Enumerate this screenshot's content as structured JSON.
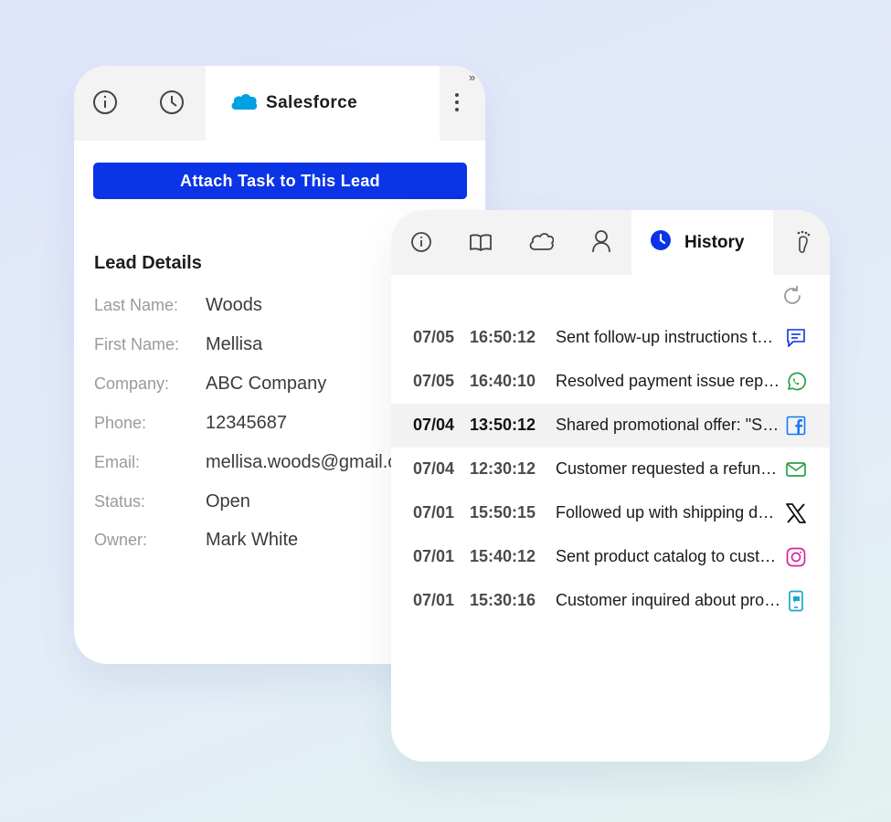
{
  "salesforce_panel": {
    "tabs": [
      {
        "icon": "info-icon"
      },
      {
        "icon": "clock-icon"
      },
      {
        "icon": "salesforce-cloud-icon",
        "label": "Salesforce",
        "active": true
      }
    ],
    "menu_icon": "more-vertical-icon",
    "attach_button_label": "Attach Task to This Lead",
    "lead_details": {
      "title": "Lead Details",
      "fields": [
        {
          "label": "Last Name:",
          "value": "Woods"
        },
        {
          "label": "First Name:",
          "value": "Mellisa"
        },
        {
          "label": "Company:",
          "value": "ABC Company"
        },
        {
          "label": "Phone:",
          "value": "12345687"
        },
        {
          "label": "Email:",
          "value": "mellisa.woods@gmail.com"
        },
        {
          "label": "Status:",
          "value": "Open"
        },
        {
          "label": "Owner:",
          "value": "Mark White"
        }
      ]
    }
  },
  "history_panel": {
    "tabs": [
      {
        "icon": "info-icon"
      },
      {
        "icon": "book-icon"
      },
      {
        "icon": "cloud-icon"
      },
      {
        "icon": "user-icon"
      },
      {
        "icon": "clock-icon",
        "label": "History",
        "active": true
      },
      {
        "icon": "footprint-icon"
      }
    ],
    "refresh_icon": "refresh-icon",
    "items": [
      {
        "date": "07/05",
        "time": "16:50:12",
        "text": "Sent follow-up instructions to the customer",
        "channel": "chat-icon"
      },
      {
        "date": "07/05",
        "time": "16:40:10",
        "text": "Resolved payment issue reported by customer",
        "channel": "whatsapp-icon"
      },
      {
        "date": "07/04",
        "time": "13:50:12",
        "text": "Shared promotional offer: \"Summer Sale\"",
        "channel": "facebook-icon"
      },
      {
        "date": "07/04",
        "time": "12:30:12",
        "text": "Customer requested a refund for order",
        "channel": "email-icon"
      },
      {
        "date": "07/01",
        "time": "15:50:15",
        "text": "Followed up with shipping details",
        "channel": "x-icon"
      },
      {
        "date": "07/01",
        "time": "15:40:12",
        "text": "Sent product catalog to customer",
        "channel": "instagram-icon"
      },
      {
        "date": "07/01",
        "time": "15:30:16",
        "text": "Customer inquired about product availability",
        "channel": "sms-icon"
      }
    ]
  },
  "colors": {
    "accent": "#0a34e6",
    "salesforce": "#00a1e0",
    "whatsapp": "#25a244",
    "facebook": "#1877f2",
    "instagram": "#d6249f",
    "sms": "#17a9c9"
  }
}
